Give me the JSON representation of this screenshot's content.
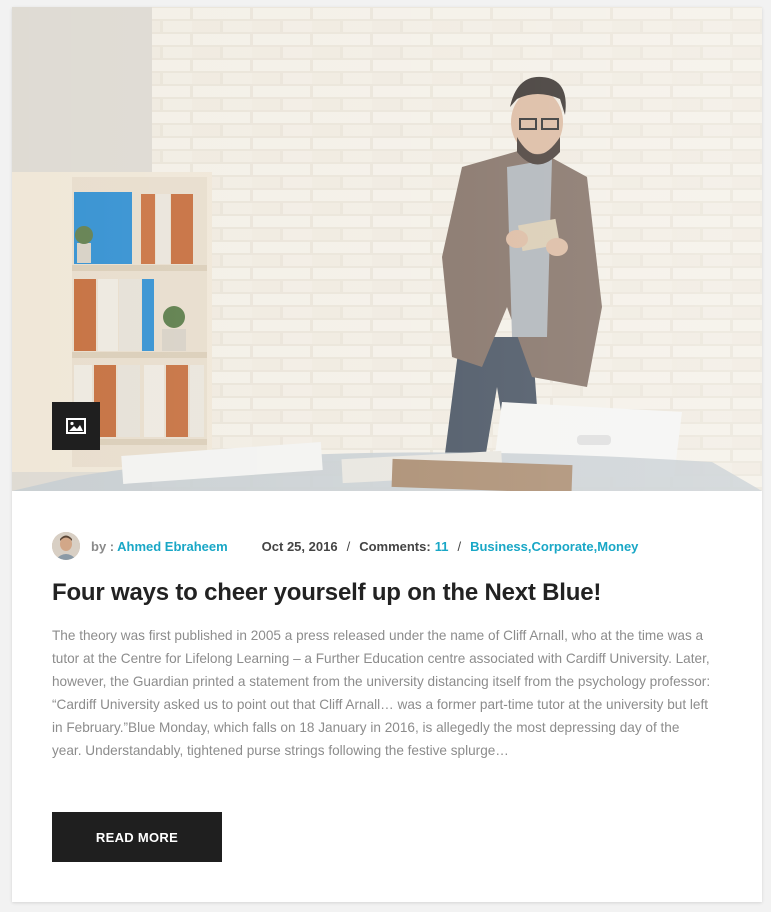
{
  "post": {
    "format_icon": "image-icon",
    "author_prefix": "by :",
    "author_name": "Ahmed Ebraheem",
    "date": "Oct 25, 2016",
    "separator": "/",
    "comments_label": "Comments:",
    "comments_count": "11",
    "categories": [
      "Business",
      ",Corporate",
      ",Money"
    ],
    "title": "Four ways to cheer yourself up on the Next Blue!",
    "excerpt": "The theory was first published in 2005 a press released under the name of Cliff Arnall, who at the time was a tutor at the Centre for Lifelong Learning – a Further Education centre associated with Cardiff University. Later, however, the Guardian printed a statement from the university distancing itself from the psychology professor: “Cardiff University asked us to point out that Cliff Arnall… was a former part-time tutor at the university but left in February.”Blue Monday, which falls on 18 January in 2016, is allegedly the most depressing day of the year. Understandably, tightened purse strings following the festive splurge…",
    "read_more_label": "READ MORE"
  },
  "colors": {
    "accent": "#19a7c6",
    "button_bg": "#1f1f1f",
    "title": "#222222",
    "body_text": "#8c8c8c"
  }
}
